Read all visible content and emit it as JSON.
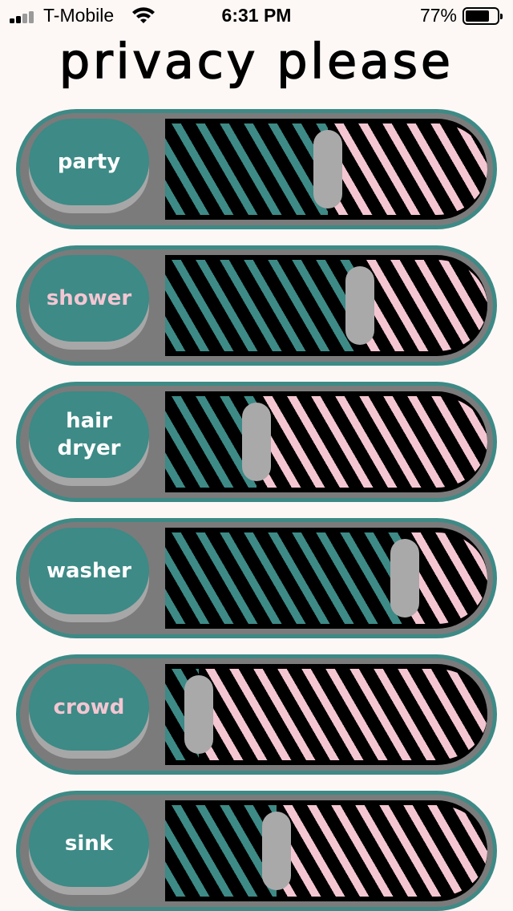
{
  "status_bar": {
    "carrier": "T-Mobile",
    "time": "6:31 PM",
    "battery_percent": "77%",
    "battery_level": 0.77,
    "signal_bars": 4,
    "signal_bars_active": 2
  },
  "title": "privacy please",
  "colors": {
    "teal": "#3d8a86",
    "pink": "#f4c6d2",
    "white_label": "#ffffff",
    "pink_label": "#f4c6d2",
    "track": "#000000",
    "thumb": "#a9a9a9",
    "frame": "#7b7b7b"
  },
  "sounds": [
    {
      "label": "party",
      "label_color": "#ffffff",
      "level": 0.46
    },
    {
      "label": "shower",
      "label_color": "#f4c6d2",
      "level": 0.56
    },
    {
      "label": "hair\ndryer",
      "label_color": "#ffffff",
      "level": 0.24
    },
    {
      "label": "washer",
      "label_color": "#ffffff",
      "level": 0.7
    },
    {
      "label": "crowd",
      "label_color": "#f4c6d2",
      "level": 0.06
    },
    {
      "label": "sink",
      "label_color": "#ffffff",
      "level": 0.3
    }
  ]
}
